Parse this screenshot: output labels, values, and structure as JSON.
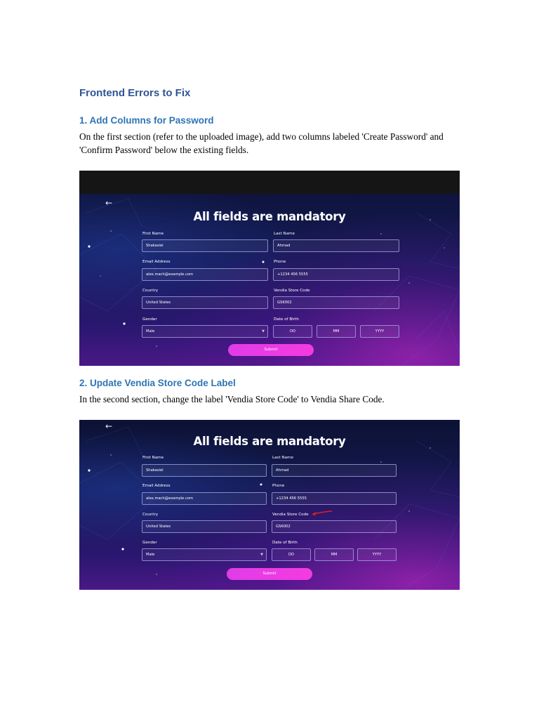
{
  "document": {
    "title": "Frontend Errors to Fix",
    "sections": [
      {
        "heading": "1. Add Columns for Password",
        "body": "On the first section (refer to the uploaded image), add two columns labeled 'Create Password' and 'Confirm Password' below the existing fields."
      },
      {
        "heading": "2. Update Vendia Store Code Label",
        "body": "In the second section, change the label 'Vendia Store Code' to Vendia Share Code."
      }
    ]
  },
  "form": {
    "back_icon": "left-arrow-icon",
    "title": "All fields are mandatory",
    "first_name_label": "First Name",
    "first_name_value": "Shakasiel",
    "last_name_label": "Last Name",
    "last_name_value": "Ahmad",
    "email_label": "Email Address",
    "email_value": "alex.mach@example.com",
    "phone_label": "Phone",
    "phone_value": "+1234 456 5555",
    "country_label": "Country",
    "country_value": "United States",
    "store_code_label": "Vendia Store Code",
    "store_code_value": "GSK002",
    "gender_label": "Gender",
    "gender_value": "Male",
    "dob_label": "Date of Birth",
    "dob_day": "DD",
    "dob_month": "MM",
    "dob_year": "YYYY",
    "submit_label": "Submit",
    "annotation_color": "#e02020",
    "accent_color": "#ee3ce6"
  }
}
